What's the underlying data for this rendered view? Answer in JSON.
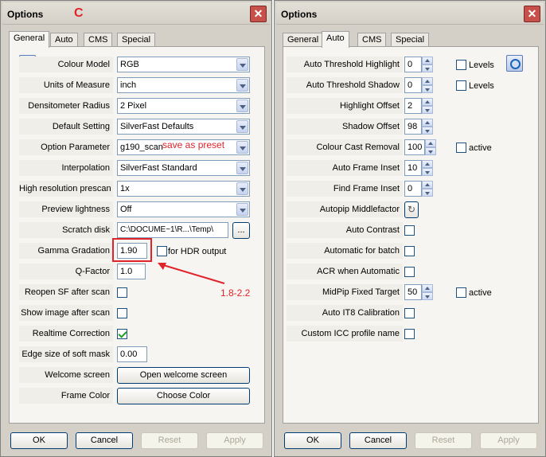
{
  "left": {
    "title": "Options",
    "marker": "C",
    "tabs": [
      "General",
      "Auto",
      "CMS",
      "Special"
    ],
    "rows": {
      "colour_model": {
        "label": "Colour Model",
        "value": "RGB"
      },
      "units": {
        "label": "Units of Measure",
        "value": "inch"
      },
      "densitometer": {
        "label": "Densitometer Radius",
        "value": "2 Pixel"
      },
      "default_setting": {
        "label": "Default Setting",
        "value": "SilverFast Defaults"
      },
      "option_param": {
        "label": "Option Parameter",
        "value": "g190_scan"
      },
      "interpolation": {
        "label": "Interpolation",
        "value": "SilverFast Standard"
      },
      "hires": {
        "label": "High resolution prescan",
        "value": "1x"
      },
      "preview": {
        "label": "Preview lightness",
        "value": "Off"
      },
      "scratch": {
        "label": "Scratch disk",
        "value": "C:\\DOCUME~1\\R...\\Temp\\",
        "button": "..."
      },
      "gamma": {
        "label": "Gamma Gradation",
        "value": "1.90",
        "hdr_label": "for HDR output"
      },
      "qfactor": {
        "label": "Q-Factor",
        "value": "1.0"
      },
      "reopen": {
        "label": "Reopen SF after scan"
      },
      "show_image": {
        "label": "Show image after scan"
      },
      "realtime": {
        "label": "Realtime Correction"
      },
      "edge": {
        "label": "Edge size of soft mask",
        "value": "0.00"
      },
      "welcome": {
        "label": "Welcome screen",
        "button": "Open welcome screen"
      },
      "frame_color": {
        "label": "Frame Color",
        "button": "Choose Color"
      }
    },
    "annotations": {
      "save_preset": "save as preset",
      "range": "1.8-2.2"
    },
    "footer": {
      "ok": "OK",
      "cancel": "Cancel",
      "reset": "Reset",
      "apply": "Apply"
    }
  },
  "right": {
    "title": "Options",
    "tabs": [
      "General",
      "Auto",
      "CMS",
      "Special"
    ],
    "rows": {
      "ath": {
        "label": "Auto Threshold Highlight",
        "value": "0",
        "check_label": "Levels"
      },
      "ats": {
        "label": "Auto Threshold Shadow",
        "value": "0",
        "check_label": "Levels"
      },
      "hl": {
        "label": "Highlight Offset",
        "value": "2"
      },
      "sh": {
        "label": "Shadow Offset",
        "value": "98"
      },
      "ccr": {
        "label": "Colour Cast Removal",
        "value": "100",
        "check_label": "active"
      },
      "afi": {
        "label": "Auto Frame Inset",
        "value": "10"
      },
      "ffi": {
        "label": "Find Frame Inset",
        "value": "0"
      },
      "autopip": {
        "label": "Autopip Middlefactor"
      },
      "ac": {
        "label": "Auto Contrast"
      },
      "afb": {
        "label": "Automatic for batch"
      },
      "acr": {
        "label": "ACR when Automatic"
      },
      "midpip": {
        "label": "MidPip Fixed Target",
        "value": "50",
        "check_label": "active"
      },
      "it8": {
        "label": "Auto IT8 Calibration"
      },
      "icc": {
        "label": "Custom ICC profile name"
      }
    },
    "footer": {
      "ok": "OK",
      "cancel": "Cancel",
      "reset": "Reset",
      "apply": "Apply"
    }
  },
  "colors": {
    "annotation": "#e0242a",
    "check": "#21a121"
  }
}
